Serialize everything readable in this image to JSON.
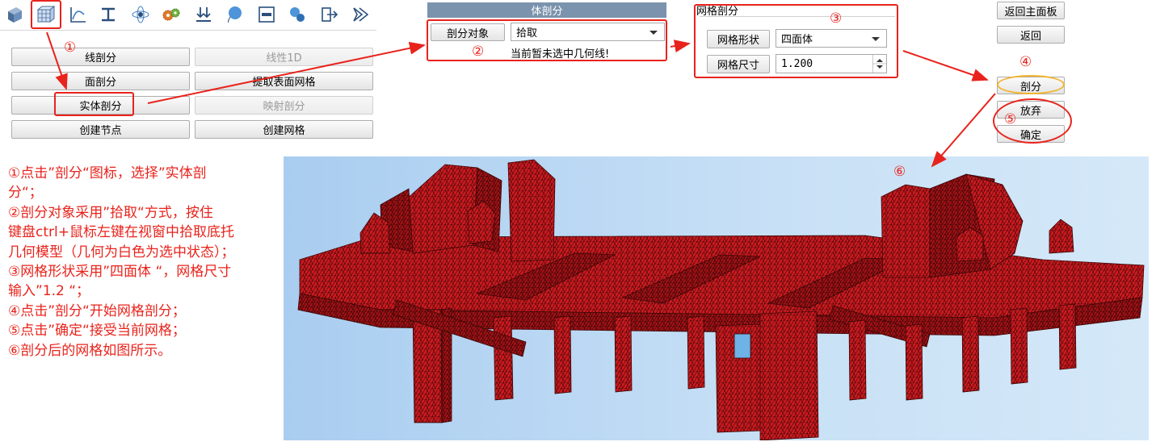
{
  "toolbar": {
    "icons": [
      "solid-cube-icon",
      "mesh-grid-icon",
      "curve-axis-icon",
      "beam-section-icon",
      "atom-icon",
      "gear-pair-icon",
      "load-arrows-icon",
      "balloon-icon",
      "plate-section-icon",
      "spheres-icon",
      "export-icon",
      "play-arrow-icon"
    ]
  },
  "left_panel": {
    "buttons": [
      {
        "label": "线剖分",
        "enabled": true
      },
      {
        "label": "线性1D",
        "enabled": false
      },
      {
        "label": "面剖分",
        "enabled": true
      },
      {
        "label": "提取表面网格",
        "enabled": true
      },
      {
        "label": "实体剖分",
        "enabled": true
      },
      {
        "label": "映射剖分",
        "enabled": false
      },
      {
        "label": "创建节点",
        "enabled": true
      },
      {
        "label": "创建网格",
        "enabled": true
      }
    ]
  },
  "body_mesh_panel": {
    "title": "体剖分",
    "target_label": "剖分对象",
    "target_value": "拾取",
    "status": "当前暂未选中几何线!"
  },
  "mesh_panel": {
    "title": "网格剖分",
    "shape_label": "网格形状",
    "shape_value": "四面体",
    "size_label": "网格尺寸",
    "size_value": "1.200"
  },
  "right_panel": {
    "back_main": "返回主面板",
    "back": "返回",
    "mesh": "剖分",
    "discard": "放弃",
    "confirm": "确定"
  },
  "markers": {
    "m1": "①",
    "m2": "②",
    "m3": "③",
    "m4": "④",
    "m5": "⑤",
    "m6": "⑥"
  },
  "instructions": [
    "①点击”剖分“图标，选择”实体剖",
    "分“；",
    "②剖分对象采用”拾取“方式，按住",
    "键盘ctrl+鼠标左键在视窗中拾取底托",
    "几何模型（几何为白色为选中状态）；",
    "③网格形状采用”四面体 “，网格尺寸",
    "输入”1.2 “；",
    "④点击”剖分“开始网格剖分；",
    "⑤点击”确定“接受当前网格；",
    "⑥剖分后的网格如图所示。"
  ],
  "colors": {
    "annotation_red": "#e8231c",
    "panel_header": "#7b93ad",
    "mesh_red": "#c8161b",
    "highlight_orange": "#f2b430"
  }
}
